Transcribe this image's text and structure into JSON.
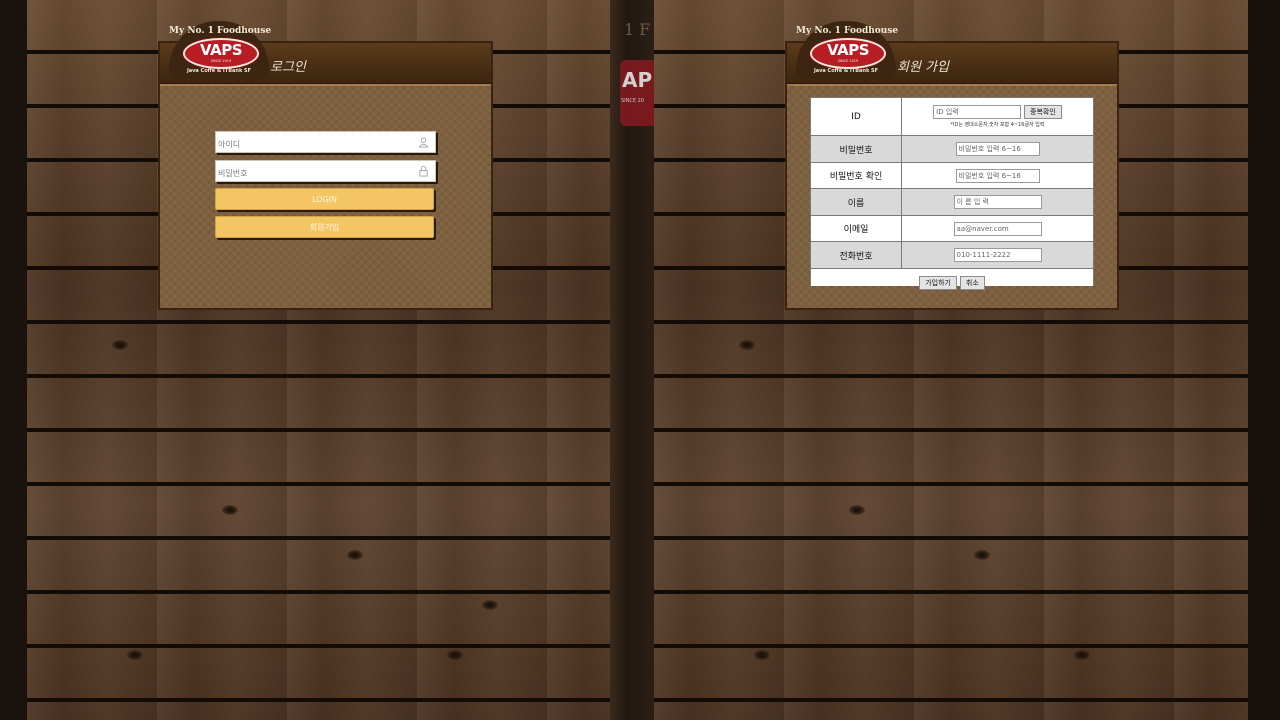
{
  "brand": {
    "tagline": "My No. 1 Foodhouse",
    "name": "VAPS",
    "since": "SINCE 2019",
    "sub": "Java Coffe & ITBank SF"
  },
  "background_ghost": {
    "text": "1 F",
    "logo_text": "AP",
    "since": "SINCE 20"
  },
  "login": {
    "title": "로그인",
    "id_placeholder": "아이디",
    "pw_placeholder": "비밀번호",
    "login_label": "LOGIN",
    "join_label": "회원가입",
    "id_icon": "user-icon",
    "pw_icon": "lock-icon"
  },
  "signup": {
    "title": "회원 가입",
    "id_label": "ID",
    "id_placeholder": "ID 입력",
    "dup_check_label": "중복확인",
    "id_hint": "*ID는 영대소문자,숫자 포함 4~16글자 입력",
    "pw_label": "비밀번호",
    "pw_placeholder": "비밀번호 입력 6~16",
    "pw_confirm_label": "비밀번호 확인",
    "pw_confirm_placeholder": "비밀번호 입력 6~16",
    "name_label": "이름",
    "name_placeholder": "이 름 입 력",
    "email_label": "이메일",
    "email_placeholder": "aa@naver.com",
    "phone_label": "전화번호",
    "phone_placeholder": "010-1111-2222",
    "submit_label": "가입하기",
    "cancel_label": "취소"
  },
  "colors": {
    "gold_button": "#f4c563",
    "brand_red": "#b81d24",
    "header_brown": "#4a2e15"
  }
}
